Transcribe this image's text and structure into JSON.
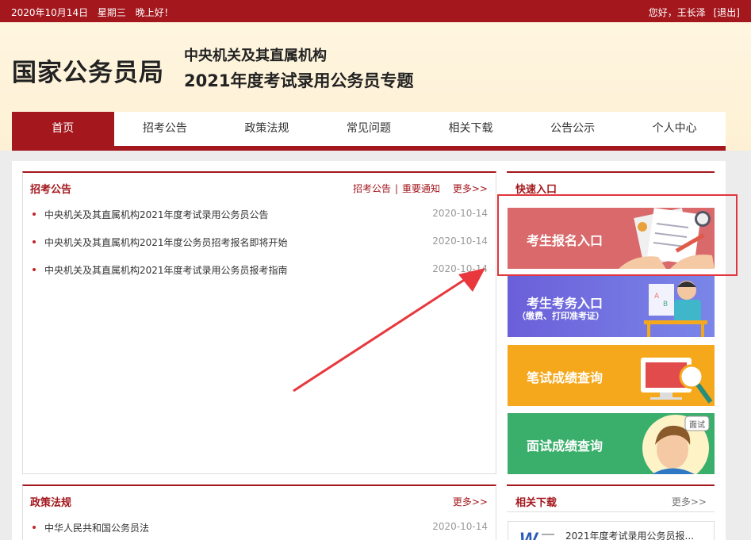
{
  "topbar": {
    "date": "2020年10月14日",
    "weekday": "星期三",
    "greeting": "晚上好！",
    "user_greeting": "您好，王长泽",
    "logout": "[退出]"
  },
  "header": {
    "logo": "国家公务员局",
    "subtitle1": "中央机关及其直属机构",
    "subtitle2": "2021年度考试录用公务员专题"
  },
  "nav": [
    "首页",
    "招考公告",
    "政策法规",
    "常见问题",
    "相关下载",
    "公告公示",
    "个人中心"
  ],
  "announcements": {
    "title": "招考公告",
    "link1": "招考公告",
    "sep": "|",
    "link2": "重要通知",
    "more": "更多>>",
    "items": [
      {
        "title": "中央机关及其直属机构2021年度考试录用公务员公告",
        "date": "2020-10-14"
      },
      {
        "title": "中央机关及其直属机构2021年度公务员招考报名即将开始",
        "date": "2020-10-14"
      },
      {
        "title": "中央机关及其直属机构2021年度考试录用公务员报考指南",
        "date": "2020-10-14"
      }
    ]
  },
  "quick": {
    "title": "快速入口",
    "cards": [
      {
        "label": "考生报名入口",
        "color": "#d9696b"
      },
      {
        "label": "考生考务入口",
        "sub": "（缴费、打印准考证）",
        "color": "#6f6fd8"
      },
      {
        "label": "笔试成绩查询",
        "color": "#f5a81c"
      },
      {
        "label": "面试成绩查询",
        "badge": "面试",
        "color": "#3aae6b"
      }
    ]
  },
  "policy": {
    "title": "政策法规",
    "more": "更多>>",
    "items": [
      {
        "title": "中华人民共和国公务员法",
        "date": "2020-10-14"
      }
    ]
  },
  "downloads": {
    "title": "相关下载",
    "more": "更多>>",
    "items": [
      {
        "title": "2021年度考试录用公务员报..."
      }
    ]
  },
  "colors": {
    "brand": "#a3171d",
    "highlight": "#e0363c",
    "arrow": "#e8383d"
  }
}
